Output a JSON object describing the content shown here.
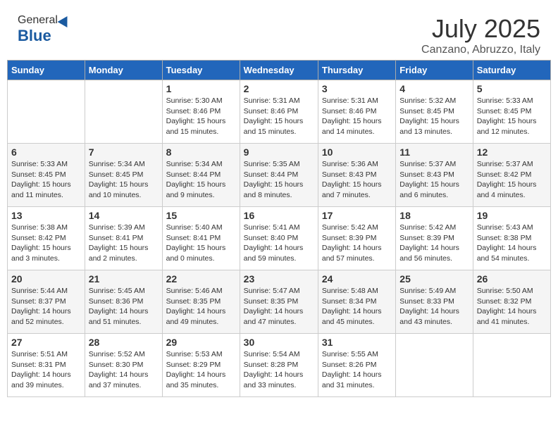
{
  "logo": {
    "general": "General",
    "blue": "Blue"
  },
  "title": "July 2025",
  "subtitle": "Canzano, Abruzzo, Italy",
  "days_header": [
    "Sunday",
    "Monday",
    "Tuesday",
    "Wednesday",
    "Thursday",
    "Friday",
    "Saturday"
  ],
  "weeks": [
    [
      {
        "day": "",
        "info": ""
      },
      {
        "day": "",
        "info": ""
      },
      {
        "day": "1",
        "info": "Sunrise: 5:30 AM\nSunset: 8:46 PM\nDaylight: 15 hours\nand 15 minutes."
      },
      {
        "day": "2",
        "info": "Sunrise: 5:31 AM\nSunset: 8:46 PM\nDaylight: 15 hours\nand 15 minutes."
      },
      {
        "day": "3",
        "info": "Sunrise: 5:31 AM\nSunset: 8:46 PM\nDaylight: 15 hours\nand 14 minutes."
      },
      {
        "day": "4",
        "info": "Sunrise: 5:32 AM\nSunset: 8:45 PM\nDaylight: 15 hours\nand 13 minutes."
      },
      {
        "day": "5",
        "info": "Sunrise: 5:33 AM\nSunset: 8:45 PM\nDaylight: 15 hours\nand 12 minutes."
      }
    ],
    [
      {
        "day": "6",
        "info": "Sunrise: 5:33 AM\nSunset: 8:45 PM\nDaylight: 15 hours\nand 11 minutes."
      },
      {
        "day": "7",
        "info": "Sunrise: 5:34 AM\nSunset: 8:45 PM\nDaylight: 15 hours\nand 10 minutes."
      },
      {
        "day": "8",
        "info": "Sunrise: 5:34 AM\nSunset: 8:44 PM\nDaylight: 15 hours\nand 9 minutes."
      },
      {
        "day": "9",
        "info": "Sunrise: 5:35 AM\nSunset: 8:44 PM\nDaylight: 15 hours\nand 8 minutes."
      },
      {
        "day": "10",
        "info": "Sunrise: 5:36 AM\nSunset: 8:43 PM\nDaylight: 15 hours\nand 7 minutes."
      },
      {
        "day": "11",
        "info": "Sunrise: 5:37 AM\nSunset: 8:43 PM\nDaylight: 15 hours\nand 6 minutes."
      },
      {
        "day": "12",
        "info": "Sunrise: 5:37 AM\nSunset: 8:42 PM\nDaylight: 15 hours\nand 4 minutes."
      }
    ],
    [
      {
        "day": "13",
        "info": "Sunrise: 5:38 AM\nSunset: 8:42 PM\nDaylight: 15 hours\nand 3 minutes."
      },
      {
        "day": "14",
        "info": "Sunrise: 5:39 AM\nSunset: 8:41 PM\nDaylight: 15 hours\nand 2 minutes."
      },
      {
        "day": "15",
        "info": "Sunrise: 5:40 AM\nSunset: 8:41 PM\nDaylight: 15 hours\nand 0 minutes."
      },
      {
        "day": "16",
        "info": "Sunrise: 5:41 AM\nSunset: 8:40 PM\nDaylight: 14 hours\nand 59 minutes."
      },
      {
        "day": "17",
        "info": "Sunrise: 5:42 AM\nSunset: 8:39 PM\nDaylight: 14 hours\nand 57 minutes."
      },
      {
        "day": "18",
        "info": "Sunrise: 5:42 AM\nSunset: 8:39 PM\nDaylight: 14 hours\nand 56 minutes."
      },
      {
        "day": "19",
        "info": "Sunrise: 5:43 AM\nSunset: 8:38 PM\nDaylight: 14 hours\nand 54 minutes."
      }
    ],
    [
      {
        "day": "20",
        "info": "Sunrise: 5:44 AM\nSunset: 8:37 PM\nDaylight: 14 hours\nand 52 minutes."
      },
      {
        "day": "21",
        "info": "Sunrise: 5:45 AM\nSunset: 8:36 PM\nDaylight: 14 hours\nand 51 minutes."
      },
      {
        "day": "22",
        "info": "Sunrise: 5:46 AM\nSunset: 8:35 PM\nDaylight: 14 hours\nand 49 minutes."
      },
      {
        "day": "23",
        "info": "Sunrise: 5:47 AM\nSunset: 8:35 PM\nDaylight: 14 hours\nand 47 minutes."
      },
      {
        "day": "24",
        "info": "Sunrise: 5:48 AM\nSunset: 8:34 PM\nDaylight: 14 hours\nand 45 minutes."
      },
      {
        "day": "25",
        "info": "Sunrise: 5:49 AM\nSunset: 8:33 PM\nDaylight: 14 hours\nand 43 minutes."
      },
      {
        "day": "26",
        "info": "Sunrise: 5:50 AM\nSunset: 8:32 PM\nDaylight: 14 hours\nand 41 minutes."
      }
    ],
    [
      {
        "day": "27",
        "info": "Sunrise: 5:51 AM\nSunset: 8:31 PM\nDaylight: 14 hours\nand 39 minutes."
      },
      {
        "day": "28",
        "info": "Sunrise: 5:52 AM\nSunset: 8:30 PM\nDaylight: 14 hours\nand 37 minutes."
      },
      {
        "day": "29",
        "info": "Sunrise: 5:53 AM\nSunset: 8:29 PM\nDaylight: 14 hours\nand 35 minutes."
      },
      {
        "day": "30",
        "info": "Sunrise: 5:54 AM\nSunset: 8:28 PM\nDaylight: 14 hours\nand 33 minutes."
      },
      {
        "day": "31",
        "info": "Sunrise: 5:55 AM\nSunset: 8:26 PM\nDaylight: 14 hours\nand 31 minutes."
      },
      {
        "day": "",
        "info": ""
      },
      {
        "day": "",
        "info": ""
      }
    ]
  ]
}
